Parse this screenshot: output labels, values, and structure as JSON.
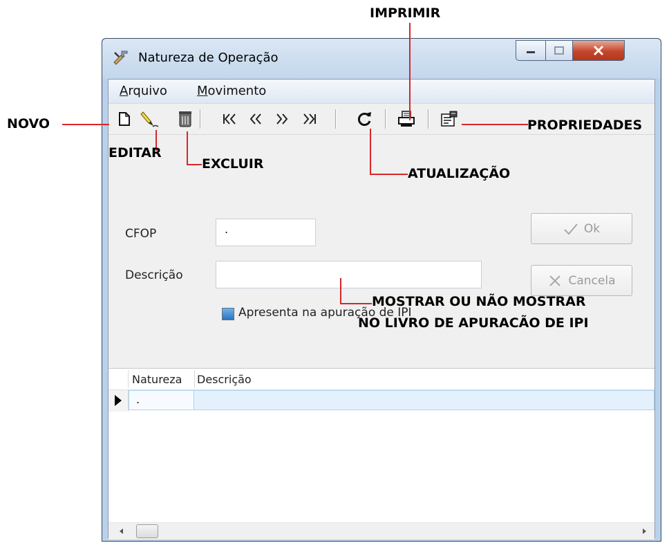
{
  "window": {
    "title": "Natureza de Operação",
    "icon": "tools-icon",
    "controls": [
      "minimize-icon",
      "maximize-icon",
      "close-icon"
    ]
  },
  "menu": {
    "arquivo_accel": "A",
    "arquivo_rest": "rquivo",
    "movimento_accel": "M",
    "movimento_rest": "ovimento"
  },
  "toolbar": {
    "items": [
      "new-icon",
      "edit-icon",
      "delete-icon",
      "first-icon",
      "prior-icon",
      "next-icon",
      "last-icon",
      "refresh-icon",
      "print-icon",
      "properties-icon"
    ]
  },
  "form": {
    "cfop_label": "CFOP",
    "cfop_value": ".",
    "descricao_label": "Descrição",
    "descricao_value": "",
    "checkbox_label": "Apresenta na apuração de IPI",
    "checkbox_checked": true,
    "ok_label": "Ok",
    "cancela_label": "Cancela"
  },
  "grid": {
    "columns": [
      "Natureza",
      "Descrição"
    ],
    "rows": [
      [
        ".",
        " "
      ]
    ]
  },
  "annotations": {
    "novo": "NOVO",
    "editar": "EDITAR",
    "excluir": "EXCLUIR",
    "imprimir": "IMPRIMIR",
    "propriedades": "PROPRIEDADES",
    "atualizacao": "ATUALIZAÇÃO",
    "mostrar_line1": "MOSTRAR OU NÃO MOSTRAR",
    "mostrar_line2": "NO LIVRO DE APURACÃO DE IPI"
  },
  "colors": {
    "annotation_line": "#d6262b",
    "close_button": "#c3462c",
    "selection": "#e4f1fc"
  }
}
